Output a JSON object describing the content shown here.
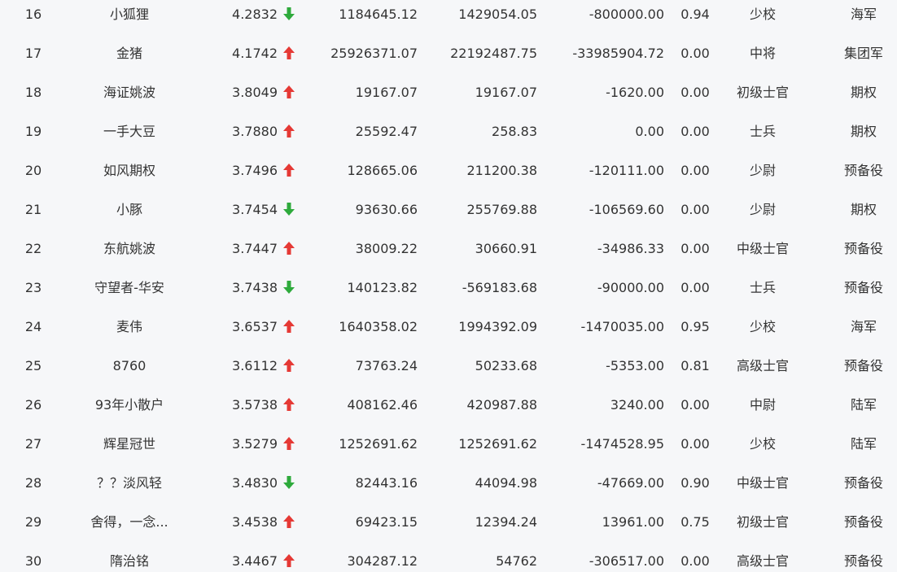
{
  "colors": {
    "background": "#f6f7f9",
    "text": "#333333",
    "up": "#e53935",
    "down": "#2eaa3c"
  },
  "rows": [
    {
      "rank": "16",
      "name": "小狐狸",
      "score": "4.2832",
      "trend": "down",
      "v1": "1184645.12",
      "v2": "1429054.05",
      "v3": "-800000.00",
      "ratio": "0.94",
      "rank_title": "少校",
      "group": "海军"
    },
    {
      "rank": "17",
      "name": "金猪",
      "score": "4.1742",
      "trend": "up",
      "v1": "25926371.07",
      "v2": "22192487.75",
      "v3": "-33985904.72",
      "ratio": "0.00",
      "rank_title": "中将",
      "group": "集团军"
    },
    {
      "rank": "18",
      "name": "海证姚波",
      "score": "3.8049",
      "trend": "up",
      "v1": "19167.07",
      "v2": "19167.07",
      "v3": "-1620.00",
      "ratio": "0.00",
      "rank_title": "初级士官",
      "group": "期权"
    },
    {
      "rank": "19",
      "name": "一手大豆",
      "score": "3.7880",
      "trend": "up",
      "v1": "25592.47",
      "v2": "258.83",
      "v3": "0.00",
      "ratio": "0.00",
      "rank_title": "士兵",
      "group": "期权"
    },
    {
      "rank": "20",
      "name": "如风期权",
      "score": "3.7496",
      "trend": "up",
      "v1": "128665.06",
      "v2": "211200.38",
      "v3": "-120111.00",
      "ratio": "0.00",
      "rank_title": "少尉",
      "group": "预备役"
    },
    {
      "rank": "21",
      "name": "小豚",
      "score": "3.7454",
      "trend": "down",
      "v1": "93630.66",
      "v2": "255769.88",
      "v3": "-106569.60",
      "ratio": "0.00",
      "rank_title": "少尉",
      "group": "期权"
    },
    {
      "rank": "22",
      "name": "东航姚波",
      "score": "3.7447",
      "trend": "up",
      "v1": "38009.22",
      "v2": "30660.91",
      "v3": "-34986.33",
      "ratio": "0.00",
      "rank_title": "中级士官",
      "group": "预备役"
    },
    {
      "rank": "23",
      "name": "守望者-华安",
      "score": "3.7438",
      "trend": "down",
      "v1": "140123.82",
      "v2": "-569183.68",
      "v3": "-90000.00",
      "ratio": "0.00",
      "rank_title": "士兵",
      "group": "预备役"
    },
    {
      "rank": "24",
      "name": "麦伟",
      "score": "3.6537",
      "trend": "up",
      "v1": "1640358.02",
      "v2": "1994392.09",
      "v3": "-1470035.00",
      "ratio": "0.95",
      "rank_title": "少校",
      "group": "海军"
    },
    {
      "rank": "25",
      "name": "8760",
      "score": "3.6112",
      "trend": "up",
      "v1": "73763.24",
      "v2": "50233.68",
      "v3": "-5353.00",
      "ratio": "0.81",
      "rank_title": "高级士官",
      "group": "预备役"
    },
    {
      "rank": "26",
      "name": "93年小散户",
      "score": "3.5738",
      "trend": "up",
      "v1": "408162.46",
      "v2": "420987.88",
      "v3": "3240.00",
      "ratio": "0.00",
      "rank_title": "中尉",
      "group": "陆军"
    },
    {
      "rank": "27",
      "name": "辉星冠世",
      "score": "3.5279",
      "trend": "up",
      "v1": "1252691.62",
      "v2": "1252691.62",
      "v3": "-1474528.95",
      "ratio": "0.00",
      "rank_title": "少校",
      "group": "陆军"
    },
    {
      "rank": "28",
      "name": "？？淡风轻",
      "score": "3.4830",
      "trend": "down",
      "v1": "82443.16",
      "v2": "44094.98",
      "v3": "-47669.00",
      "ratio": "0.90",
      "rank_title": "中级士官",
      "group": "预备役"
    },
    {
      "rank": "29",
      "name": "舍得，一念...",
      "score": "3.4538",
      "trend": "up",
      "v1": "69423.15",
      "v2": "12394.24",
      "v3": "13961.00",
      "ratio": "0.75",
      "rank_title": "初级士官",
      "group": "预备役"
    },
    {
      "rank": "30",
      "name": "隋治铭",
      "score": "3.4467",
      "trend": "up",
      "v1": "304287.12",
      "v2": "54762",
      "v3": "-306517.00",
      "ratio": "0.00",
      "rank_title": "高级士官",
      "group": "预备役"
    }
  ]
}
